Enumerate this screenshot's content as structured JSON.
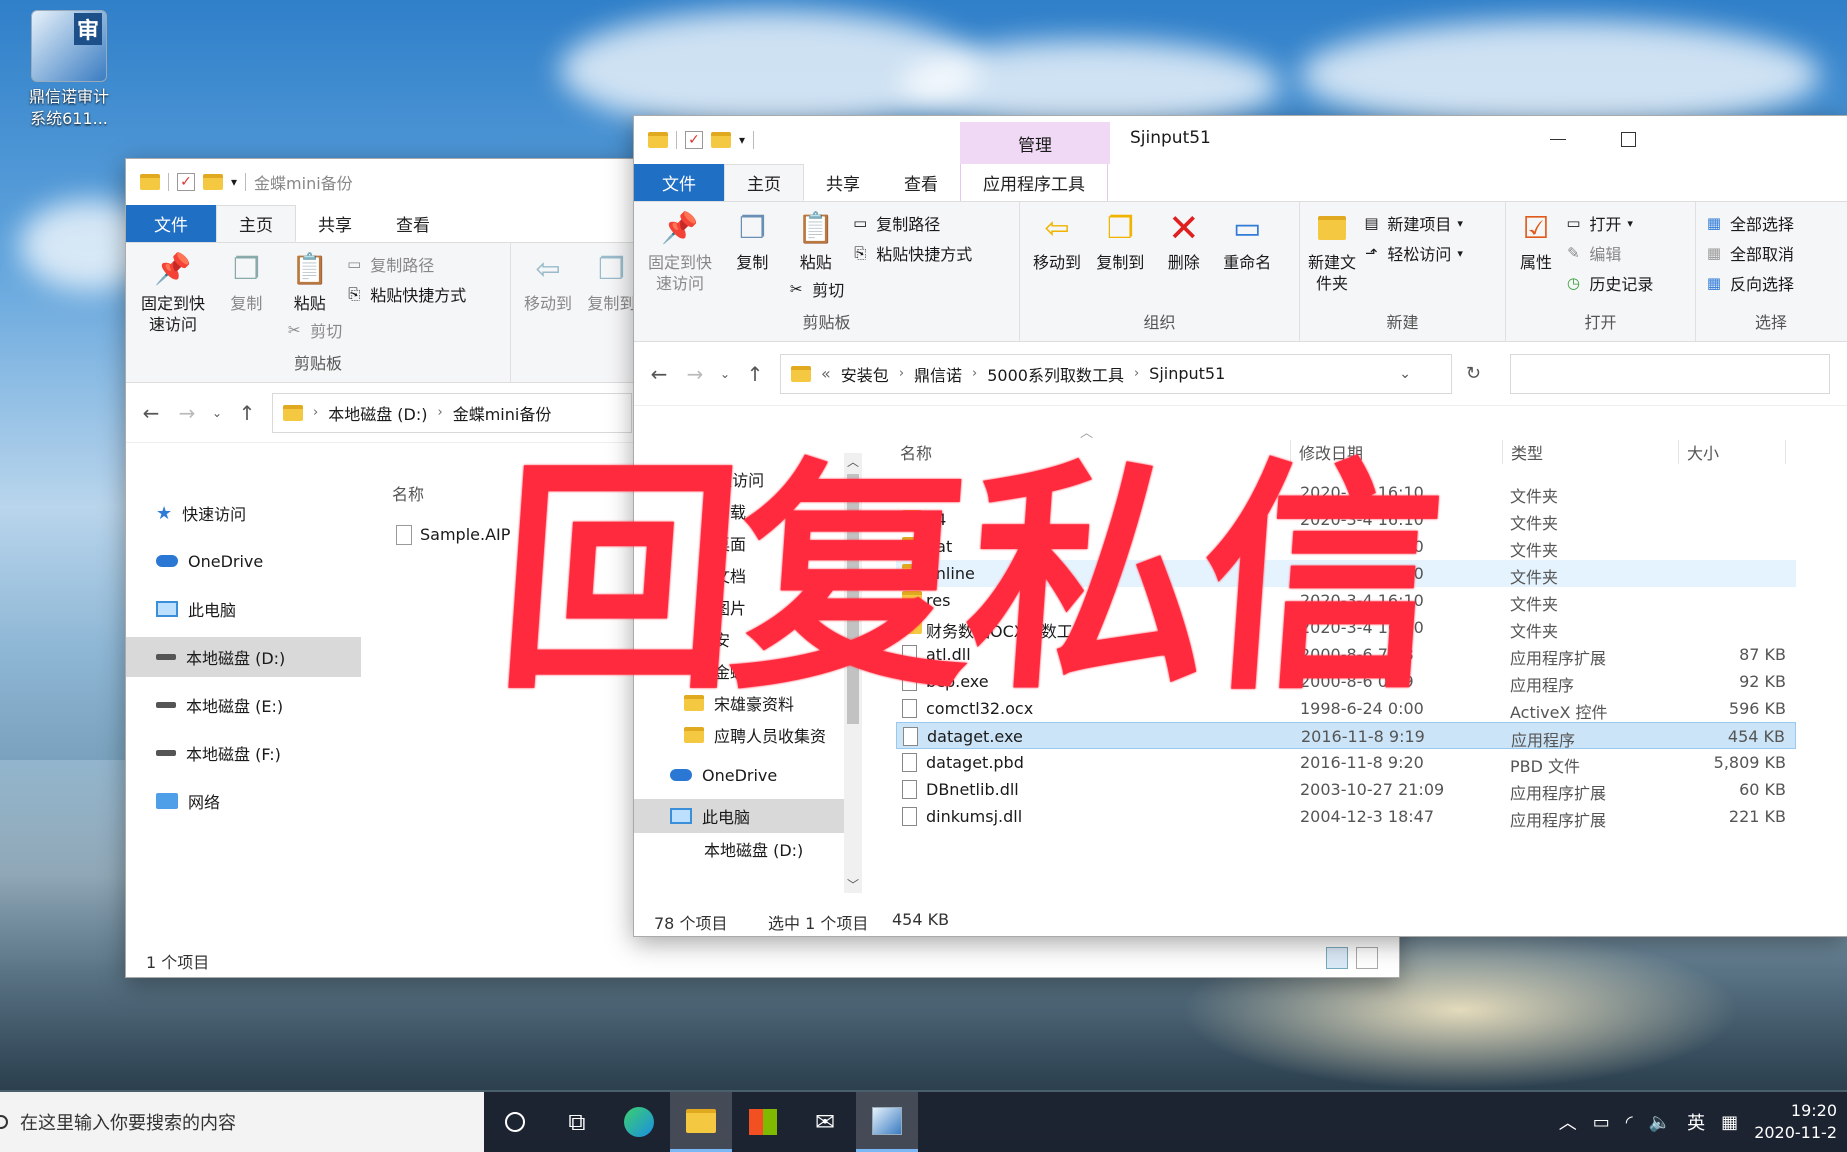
{
  "desktop": {
    "icon_label_line1": "鼎信诺审计",
    "icon_label_line2": "系统611...",
    "icon_badge": "审"
  },
  "overlay": {
    "text": "回复私信"
  },
  "back_window": {
    "title": "金蝶mini备份",
    "tabs": {
      "file": "文件",
      "home": "主页",
      "share": "共享",
      "view": "查看"
    },
    "ribbon": {
      "pin": "固定到快速访问",
      "copy": "复制",
      "paste": "粘贴",
      "copy_path": "复制路径",
      "paste_shortcut": "粘贴快捷方式",
      "cut": "剪切",
      "clipboard_group": "剪贴板",
      "move_to": "移动到",
      "copy_to": "复制到"
    },
    "address": {
      "part1": "本地磁盘 (D:)",
      "part2": "金蝶mini备份"
    },
    "nav": [
      "快速访问",
      "OneDrive",
      "此电脑",
      "本地磁盘 (D:)",
      "本地磁盘 (E:)",
      "本地磁盘 (F:)",
      "网络"
    ],
    "column_name": "名称",
    "files": [
      "Sample.AIP"
    ],
    "status": "1 个项目"
  },
  "front_window": {
    "title": "Sjinput51",
    "context_tab_top": "管理",
    "tabs": {
      "file": "文件",
      "home": "主页",
      "share": "共享",
      "view": "查看",
      "app_tools": "应用程序工具"
    },
    "ribbon": {
      "pin": "固定到快速访问",
      "copy": "复制",
      "paste": "粘贴",
      "copy_path": "复制路径",
      "paste_shortcut": "粘贴快捷方式",
      "cut": "剪切",
      "clipboard_group": "剪贴板",
      "move_to": "移动到",
      "copy_to": "复制到",
      "delete": "删除",
      "rename": "重命名",
      "organize_group": "组织",
      "new_folder": "新建文件夹",
      "new_item": "新建项目",
      "easy_access": "轻松访问",
      "new_group": "新建",
      "properties": "属性",
      "open": "打开",
      "edit": "编辑",
      "history": "历史记录",
      "open_group": "打开",
      "select_all": "全部选择",
      "select_none": "全部取消",
      "invert": "反向选择",
      "select_group": "选择"
    },
    "address": {
      "lead": "«",
      "parts": [
        "安装包",
        "鼎信诺",
        "5000系列取数工具",
        "Sjinput51"
      ]
    },
    "nav": [
      "快速访问",
      "下载",
      "桌面",
      "文档",
      "图片",
      "安",
      "金蝶mini",
      "宋雄豪资料",
      "应聘人员收集资",
      "OneDrive",
      "此电脑",
      "本地磁盘 (D:)"
    ],
    "columns": {
      "name": "名称",
      "date": "修改日期",
      "type": "类型",
      "size": "大小"
    },
    "files": [
      {
        "name": "32",
        "date": "2020-3-4 16:10",
        "type": "文件夹",
        "size": ""
      },
      {
        "name": "64",
        "date": "2020-3-4 16:10",
        "type": "文件夹",
        "size": ""
      },
      {
        "name": "dat",
        "date": "2020-3-4 16:10",
        "type": "文件夹",
        "size": ""
      },
      {
        "name": "online",
        "date": "2020-3-4 16:10",
        "type": "文件夹",
        "size": ""
      },
      {
        "name": "res",
        "date": "2020-3-4 16:10",
        "type": "文件夹",
        "size": ""
      },
      {
        "name": "财务数据OCX取数工具",
        "date": "2020-3-4 16:10",
        "type": "文件夹",
        "size": ""
      },
      {
        "name": "atl.dll",
        "date": "2000-8-6 7:28",
        "type": "应用程序扩展",
        "size": "87 KB"
      },
      {
        "name": "bcp.exe",
        "date": "2000-8-6 0:39",
        "type": "应用程序",
        "size": "92 KB"
      },
      {
        "name": "comctl32.ocx",
        "date": "1998-6-24 0:00",
        "type": "ActiveX 控件",
        "size": "596 KB"
      },
      {
        "name": "dataget.exe",
        "date": "2016-11-8 9:19",
        "type": "应用程序",
        "size": "454 KB"
      },
      {
        "name": "dataget.pbd",
        "date": "2016-11-8 9:20",
        "type": "PBD 文件",
        "size": "5,809 KB"
      },
      {
        "name": "DBnetlib.dll",
        "date": "2003-10-27 21:09",
        "type": "应用程序扩展",
        "size": "60 KB"
      },
      {
        "name": "dinkumsj.dll",
        "date": "2004-12-3 18:47",
        "type": "应用程序扩展",
        "size": "221 KB"
      }
    ],
    "status": {
      "count": "78 个项目",
      "selected": "选中 1 个项目",
      "size": "454 KB"
    }
  },
  "taskbar": {
    "search_placeholder": "在这里输入你要搜索的内容",
    "ime": "英",
    "time": "19:20",
    "date": "2020-11-2"
  }
}
